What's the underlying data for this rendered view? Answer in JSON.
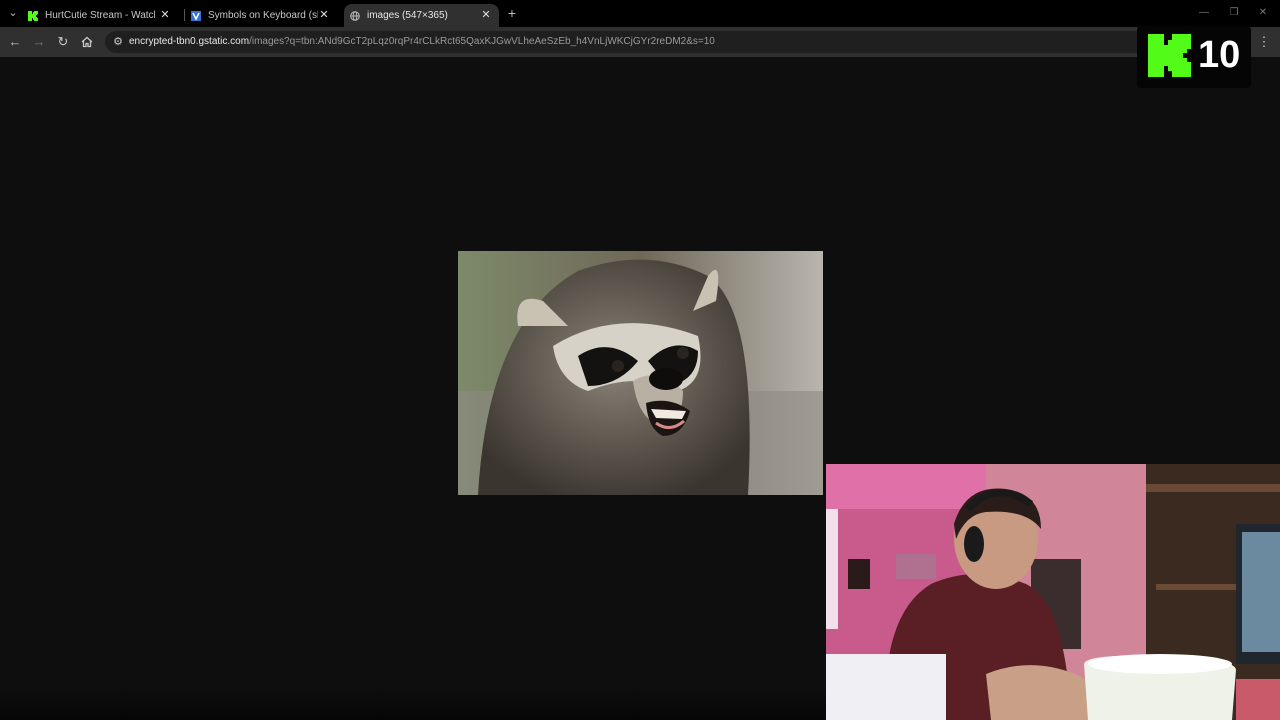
{
  "browser": {
    "tabs": [
      {
        "title": "HurtCutie Stream - Watch Live on Kick",
        "favicon": "kick-icon",
        "active": false
      },
      {
        "title": "Symbols on Keyboard (shortcuts)",
        "favicon": "symbols-site-icon",
        "active": false
      },
      {
        "title": "images (547×365)",
        "favicon": "globe-icon",
        "active": true
      }
    ],
    "address": {
      "host": "encrypted-tbn0.gstatic.com",
      "path": "/images?q=tbn:ANd9GcT2pLqz0rqPr4rCLkRct65QaxKJGwVLheAeSzEb_h4VnLjWKCjGYr2reDM2&s=10"
    }
  },
  "overlay": {
    "kick_badge": "10",
    "accent": "#53fc18"
  },
  "content": {
    "image_subject": "raccoon",
    "background": "#0e0e0e"
  }
}
